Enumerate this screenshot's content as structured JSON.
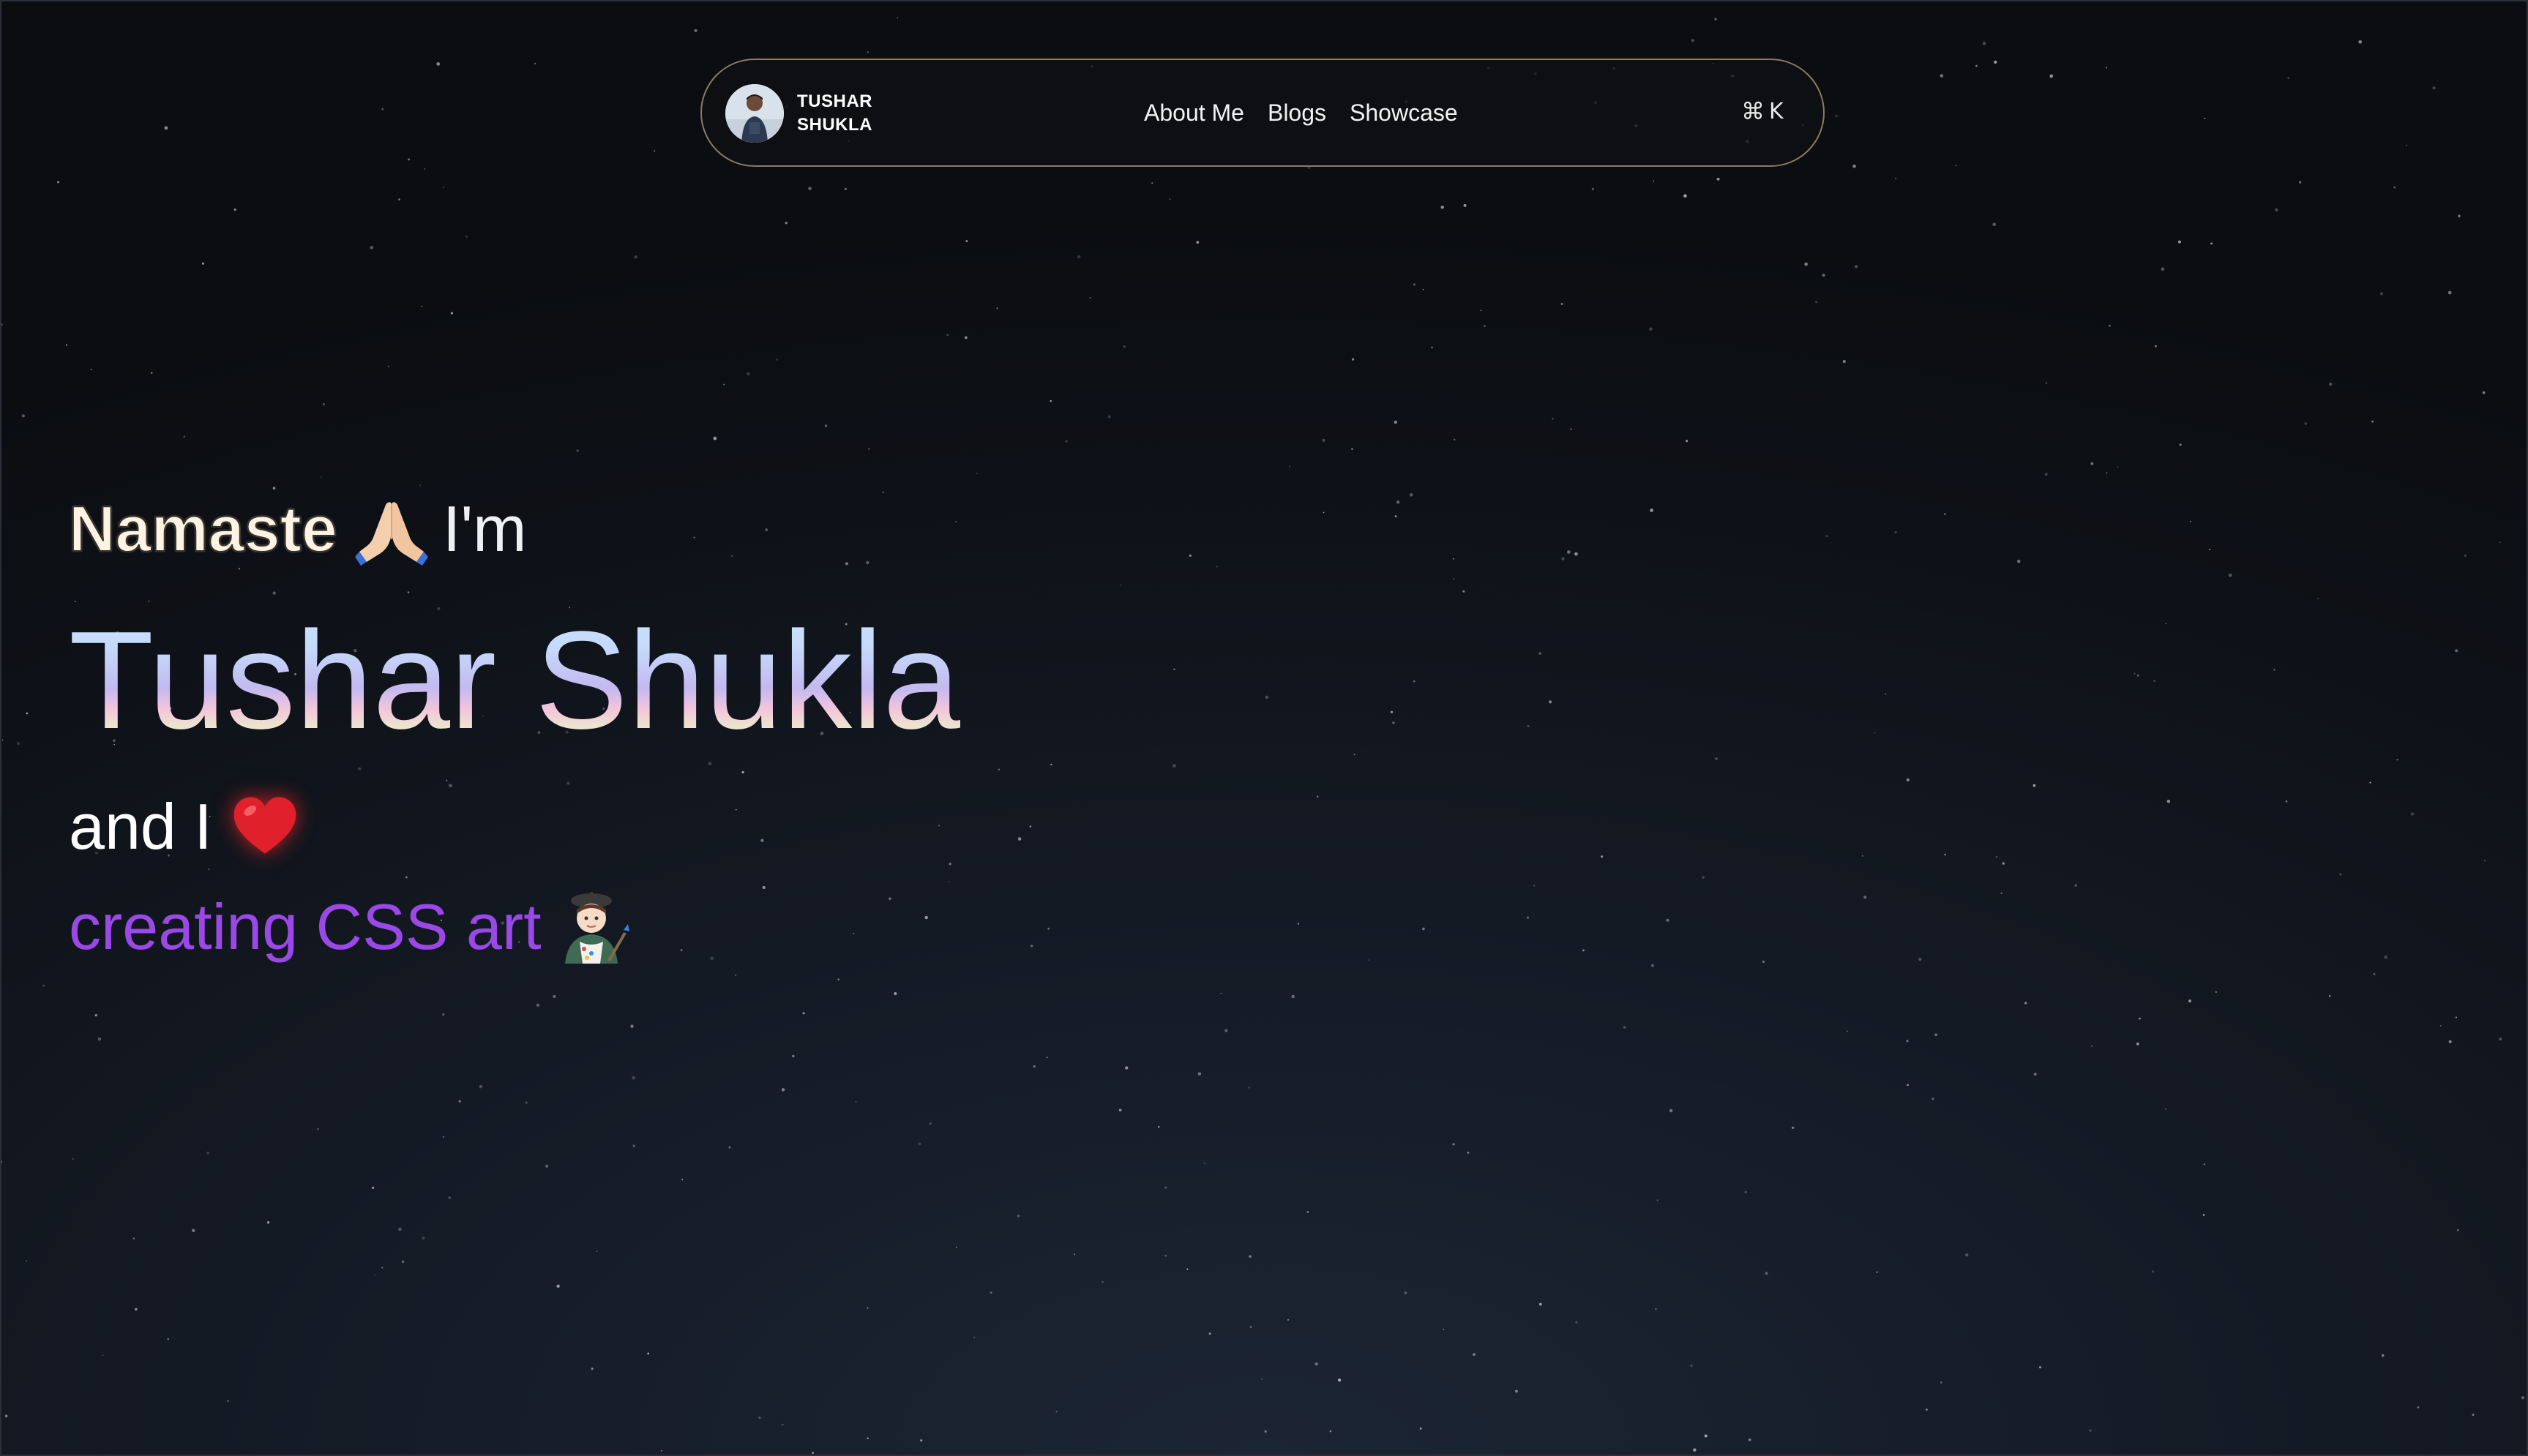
{
  "nav": {
    "brand": {
      "first_name": "TUSHAR",
      "last_name": "SHUKLA"
    },
    "links": [
      {
        "label": "About Me"
      },
      {
        "label": "Blogs"
      },
      {
        "label": "Showcase"
      }
    ],
    "command_palette": {
      "icon": "command-icon",
      "symbol": "⌘",
      "key": "K"
    }
  },
  "hero": {
    "greeting": "Namaste",
    "greeting_icon": "folded-hands-icon",
    "intro_suffix": "I'm",
    "name": "Tushar Shukla",
    "love_prefix": "and I",
    "love_icon": "red-heart-icon",
    "tagline": "creating CSS art",
    "tagline_icon": "artist-icon"
  },
  "colors": {
    "background": "#0e1117",
    "nav_border": "#8a7a63",
    "tagline": "#9a48e6",
    "heart": "#e0202a"
  }
}
